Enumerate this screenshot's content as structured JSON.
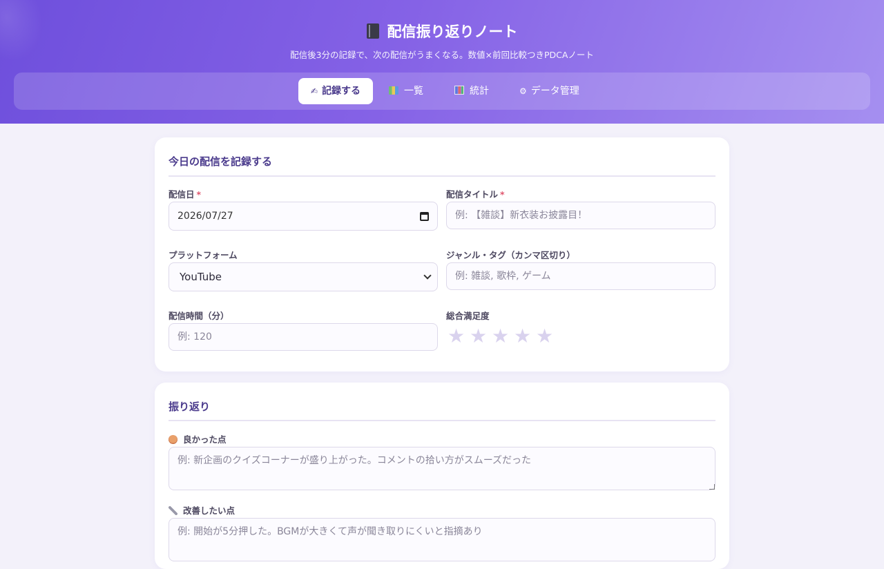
{
  "app": {
    "title": "配信振り返りノート",
    "subtitle": "配信後3分の記録で、次の配信がうまくなる。数値×前回比較つきPDCAノート"
  },
  "nav": {
    "tabs": [
      {
        "label": "記録する",
        "icon": "pencil-icon",
        "active": true
      },
      {
        "label": "一覧",
        "icon": "books-icon",
        "active": false
      },
      {
        "label": "統計",
        "icon": "bar-chart-icon",
        "active": false
      },
      {
        "label": "データ管理",
        "icon": "gear-icon",
        "active": false
      }
    ]
  },
  "record_section": {
    "heading": "今日の配信を記録する",
    "date": {
      "label": "配信日",
      "required_mark": "*",
      "value": "2026/07/27"
    },
    "title": {
      "label": "配信タイトル",
      "required_mark": "*",
      "placeholder": "例: 【雑談】新衣装お披露目！"
    },
    "platform": {
      "label": "プラットフォーム",
      "value": "YouTube"
    },
    "tags": {
      "label": "ジャンル・タグ（カンマ区切り）",
      "placeholder": "例: 雑談, 歌枠, ゲーム"
    },
    "duration": {
      "label": "配信時間（分）",
      "placeholder": "例: 120"
    },
    "satisfaction": {
      "label": "総合満足度",
      "rating": 0,
      "max": 5,
      "star": "★"
    }
  },
  "review_section": {
    "heading": "振り返り",
    "good": {
      "label": "良かった点",
      "icon": "smile-icon",
      "placeholder": "例: 新企画のクイズコーナーが盛り上がった。コメントの拾い方がスムーズだった"
    },
    "improve": {
      "label": "改善したい点",
      "icon": "wrench-icon",
      "placeholder": "例: 開始が5分押した。BGMが大きくて声が聞き取りにくいと指摘あり"
    }
  },
  "colors": {
    "accent": "#6e4fdc",
    "accent_light": "#a58ff0",
    "heading": "#4a3a8c",
    "required": "#e0566e",
    "star_inactive": "#d9d2ee"
  }
}
